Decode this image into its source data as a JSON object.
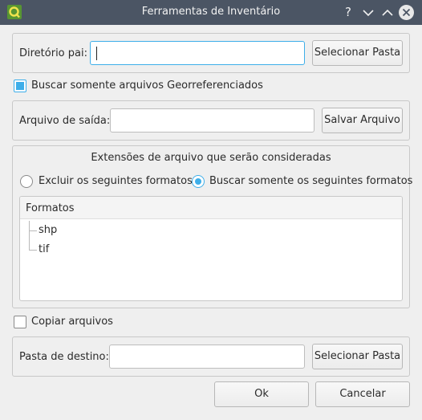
{
  "window": {
    "title": "Ferramentas de Inventário",
    "help_glyph": "?",
    "minimize_glyph": "⌄",
    "maximize_glyph": "⌃",
    "close_glyph": "✕"
  },
  "parent_dir": {
    "label": "Diretório pai:",
    "value": "",
    "button": "Selecionar Pasta"
  },
  "georef_only": {
    "label": "Buscar somente arquivos Georreferenciados",
    "checked": true
  },
  "output_file": {
    "label": "Arquivo de saída:",
    "value": "",
    "button": "Salvar Arquivo"
  },
  "extensions": {
    "title": "Extensões de arquivo que serão consideradas",
    "exclude_label": "Excluir os seguintes formatos",
    "include_label": "Buscar somente os seguintes formatos",
    "selected": "include",
    "list_header": "Formatos",
    "formats": [
      "shp",
      "tif"
    ]
  },
  "copy_files": {
    "label": "Copiar arquivos",
    "checked": false
  },
  "destination": {
    "label": "Pasta de destino:",
    "value": "",
    "button": "Selecionar Pasta"
  },
  "footer": {
    "ok": "Ok",
    "cancel": "Cancelar"
  },
  "colors": {
    "titlebar": "#4b5564",
    "accent": "#3daee9",
    "background": "#efefef"
  }
}
